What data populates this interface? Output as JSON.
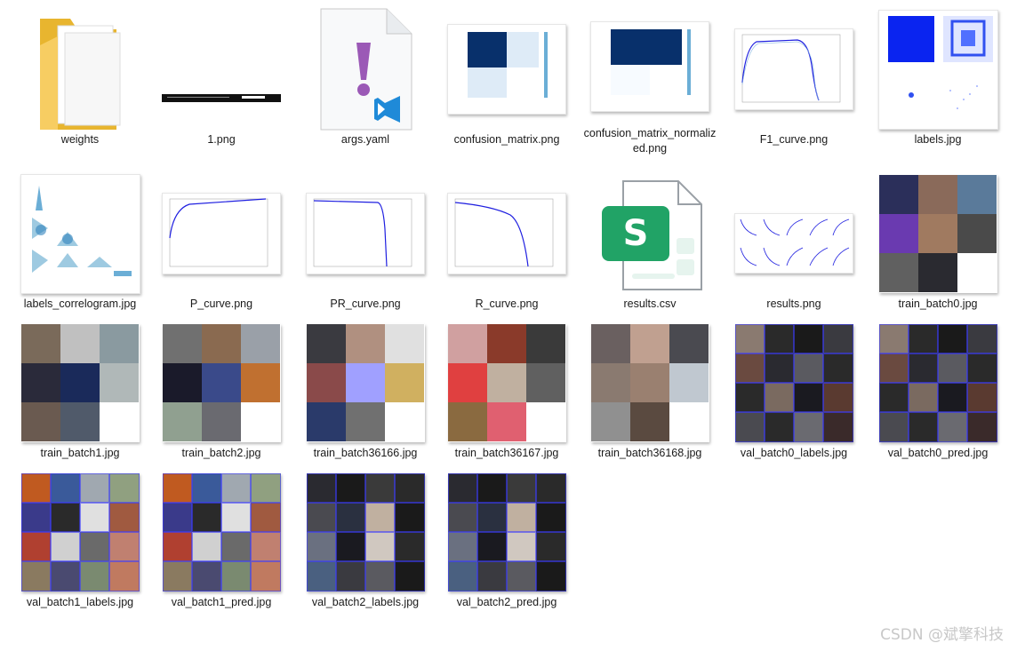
{
  "files": [
    {
      "name": "weights",
      "type": "folder"
    },
    {
      "name": "1.png",
      "type": "console-strip"
    },
    {
      "name": "args.yaml",
      "type": "yaml"
    },
    {
      "name": "confusion_matrix.png",
      "type": "matrix"
    },
    {
      "name": "confusion_matrix_normalized.png",
      "type": "matrix"
    },
    {
      "name": "F1_curve.png",
      "type": "curve"
    },
    {
      "name": "labels.jpg",
      "type": "labels"
    },
    {
      "name": "labels_correlogram.jpg",
      "type": "correlogram"
    },
    {
      "name": "P_curve.png",
      "type": "curve"
    },
    {
      "name": "PR_curve.png",
      "type": "curve"
    },
    {
      "name": "R_curve.png",
      "type": "curve"
    },
    {
      "name": "results.csv",
      "type": "csv"
    },
    {
      "name": "results.png",
      "type": "results"
    },
    {
      "name": "train_batch0.jpg",
      "type": "mosaic"
    },
    {
      "name": "train_batch1.jpg",
      "type": "mosaic"
    },
    {
      "name": "train_batch2.jpg",
      "type": "mosaic"
    },
    {
      "name": "train_batch36166.jpg",
      "type": "mosaic"
    },
    {
      "name": "train_batch36167.jpg",
      "type": "mosaic"
    },
    {
      "name": "train_batch36168.jpg",
      "type": "mosaic"
    },
    {
      "name": "val_batch0_labels.jpg",
      "type": "val-mosaic"
    },
    {
      "name": "val_batch0_pred.jpg",
      "type": "val-mosaic"
    },
    {
      "name": "val_batch1_labels.jpg",
      "type": "val-mosaic"
    },
    {
      "name": "val_batch1_pred.jpg",
      "type": "val-mosaic"
    },
    {
      "name": "val_batch2_labels.jpg",
      "type": "val-mosaic"
    },
    {
      "name": "val_batch2_pred.jpg",
      "type": "val-mosaic"
    }
  ],
  "icons": {
    "folder": "folder-icon",
    "yaml": "vscode-yaml-icon",
    "csv": "spreadsheet-s-icon"
  },
  "colors": {
    "folder": "#f5c342",
    "yaml_mark": "#9b59b6",
    "vscode_blue": "#1f8ad8",
    "csv_green": "#21a366",
    "curve_blue": "#1f1fe0"
  },
  "watermark": "CSDN @斌擎科技"
}
